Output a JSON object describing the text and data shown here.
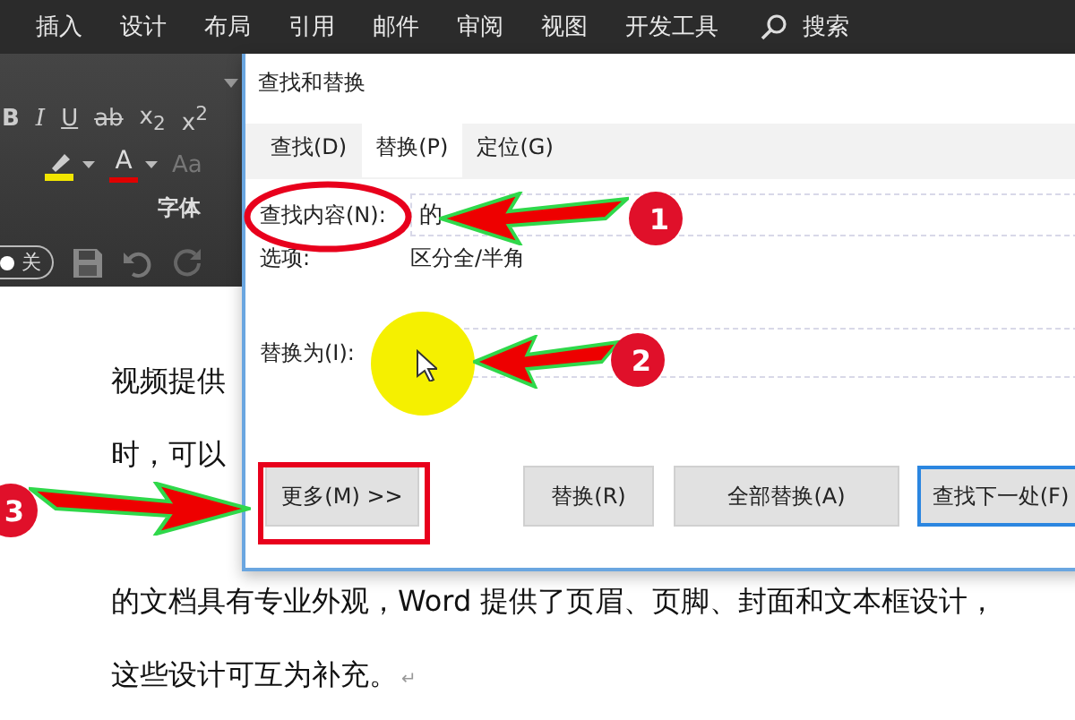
{
  "menu_bar": {
    "items": [
      "插入",
      "设计",
      "布局",
      "引用",
      "邮件",
      "审阅",
      "视图",
      "开发工具"
    ],
    "search": "搜索"
  },
  "ribbon": {
    "format_buttons": [
      "B",
      "I",
      "U",
      "ab",
      "x$_{2}$",
      "x$^{2}$"
    ],
    "color_buttons": [
      {
        "kind": "highlight",
        "color": "#f2e600"
      },
      {
        "kind": "font-color",
        "label": "A",
        "color": "#e00000"
      }
    ],
    "size_button": "Aa",
    "group_label": "字体",
    "toggle": {
      "label": "关",
      "on": false
    }
  },
  "document": {
    "lines": [
      "视频提供",
      "时，可以",
      "的文档具有专业外观，Word  提供了页眉、页脚、封面和文本框设计，",
      "这些设计可互为补充。"
    ],
    "paragraph_mark": "↵"
  },
  "dialog": {
    "title": "查找和替换",
    "tabs": [
      {
        "label": "查找(D)",
        "selected": false
      },
      {
        "label": "替换(P)",
        "selected": true
      },
      {
        "label": "定位(G)",
        "selected": false
      }
    ],
    "find_label": "查找内容(N):",
    "find_value": "的",
    "options_label": "选项:",
    "options_value": "区分全/半角",
    "replace_label": "替换为(I):",
    "buttons": [
      {
        "label": "更多(M) >>",
        "default": false
      },
      {
        "label": "替换(R)",
        "default": false
      },
      {
        "label": "全部替换(A)",
        "default": false
      },
      {
        "label": "查找下一处(F)",
        "default": true
      }
    ]
  },
  "annotations": {
    "markers": [
      "1",
      "2",
      "3"
    ]
  }
}
